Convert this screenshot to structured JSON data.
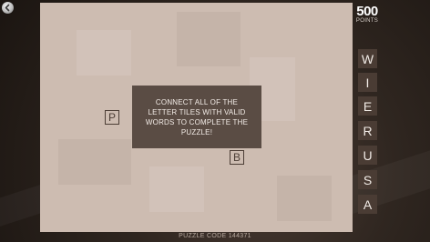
{
  "nav": {
    "back_icon": "back-arrow-icon"
  },
  "score": {
    "value": "500",
    "label": "POINTS"
  },
  "board": {
    "message": "CONNECT ALL OF THE LETTER TILES WITH VALID WORDS TO COMPLETE THE PUZZLE!",
    "tiles": [
      {
        "letter": "P"
      },
      {
        "letter": "B"
      }
    ]
  },
  "rack": {
    "letters": [
      "W",
      "I",
      "E",
      "R",
      "U",
      "S",
      "A"
    ]
  },
  "footer": {
    "puzzle_code": "PUZZLE CODE 144371"
  },
  "colors": {
    "board": "#cdbcb1",
    "message_bg": "#5a4c44",
    "rack_tile": "#4a3c34",
    "background": "#2f2620"
  }
}
